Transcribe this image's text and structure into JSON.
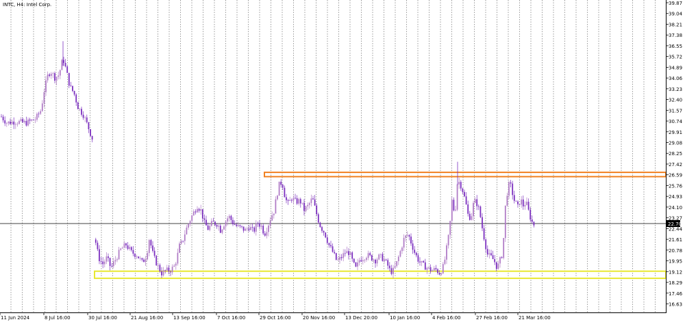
{
  "header": {
    "symbol_line": "INTC, H4: Intel Corp."
  },
  "colors": {
    "bull": "#b07cc6",
    "bear": "#7b2fbf",
    "grid": "#555555",
    "resistance": "#f08020",
    "support": "#e8e830",
    "current": "#000000"
  },
  "chart_data": {
    "type": "candlestick",
    "title": "INTC, H4: Intel Corp.",
    "y_ticks": [
      "39.87",
      "39.04",
      "38.21",
      "37.38",
      "36.55",
      "35.72",
      "34.89",
      "34.06",
      "33.23",
      "32.40",
      "31.57",
      "30.74",
      "29.91",
      "29.08",
      "28.25",
      "27.42",
      "26.59",
      "25.76",
      "24.93",
      "24.10",
      "23.27",
      "22.44",
      "21.61",
      "20.78",
      "19.95",
      "19.12",
      "18.29",
      "17.46",
      "16.63"
    ],
    "ylim": [
      16.63,
      39.87
    ],
    "x_ticks": [
      "11 Jun 2024",
      "8 Jul 16:00",
      "30 Jul 16:00",
      "21 Aug 16:00",
      "13 Sep 16:00",
      "7 Oct 16:00",
      "29 Oct 16:00",
      "20 Nov 16:00",
      "13 Dec 20:00",
      "10 Jan 16:00",
      "4 Feb 16:00",
      "27 Feb 16:00",
      "21 Mar 16:00"
    ],
    "current_price": "22.70",
    "zones": [
      {
        "name": "resistance",
        "low": 26.45,
        "high": 26.78
      },
      {
        "name": "support",
        "low": 18.6,
        "high": 19.15
      }
    ],
    "path_anchors": [
      [
        0,
        31.2
      ],
      [
        10,
        30.6
      ],
      [
        22,
        30.7
      ],
      [
        38,
        30.6
      ],
      [
        52,
        30.9
      ],
      [
        60,
        31.6
      ],
      [
        64,
        33.0
      ],
      [
        70,
        34.3
      ],
      [
        74,
        34.6
      ],
      [
        80,
        34.1
      ],
      [
        86,
        34.3
      ],
      [
        92,
        35.6
      ],
      [
        96,
        34.8
      ],
      [
        102,
        33.4
      ],
      [
        108,
        32.9
      ],
      [
        114,
        31.8
      ],
      [
        122,
        31.2
      ],
      [
        130,
        30.1
      ],
      [
        136,
        29.2
      ],
      [
        139,
        21.6
      ],
      [
        144,
        20.2
      ],
      [
        150,
        19.7
      ],
      [
        156,
        20.2
      ],
      [
        162,
        19.4
      ],
      [
        168,
        20.0
      ],
      [
        176,
        20.8
      ],
      [
        184,
        21.2
      ],
      [
        192,
        20.6
      ],
      [
        200,
        20.4
      ],
      [
        208,
        19.8
      ],
      [
        214,
        20.4
      ],
      [
        218,
        21.7
      ],
      [
        224,
        20.3
      ],
      [
        230,
        19.6
      ],
      [
        236,
        19.0
      ],
      [
        242,
        19.2
      ],
      [
        248,
        19.2
      ],
      [
        254,
        19.5
      ],
      [
        258,
        20.1
      ],
      [
        262,
        21.1
      ],
      [
        266,
        21.4
      ],
      [
        270,
        22.1
      ],
      [
        274,
        22.7
      ],
      [
        280,
        23.4
      ],
      [
        288,
        24.2
      ],
      [
        294,
        23.8
      ],
      [
        298,
        22.9
      ],
      [
        304,
        22.4
      ],
      [
        310,
        22.9
      ],
      [
        318,
        22.8
      ],
      [
        322,
        22.3
      ],
      [
        328,
        22.9
      ],
      [
        334,
        23.4
      ],
      [
        340,
        22.9
      ],
      [
        346,
        22.6
      ],
      [
        352,
        22.5
      ],
      [
        358,
        22.3
      ],
      [
        364,
        22.6
      ],
      [
        370,
        22.2
      ],
      [
        376,
        22.9
      ],
      [
        382,
        22.6
      ],
      [
        386,
        22.0
      ],
      [
        390,
        22.5
      ],
      [
        396,
        23.4
      ],
      [
        400,
        23.8
      ],
      [
        404,
        25.0
      ],
      [
        408,
        25.9
      ],
      [
        412,
        26.0
      ],
      [
        416,
        24.9
      ],
      [
        420,
        24.3
      ],
      [
        426,
        24.8
      ],
      [
        432,
        24.5
      ],
      [
        438,
        24.6
      ],
      [
        444,
        23.9
      ],
      [
        450,
        24.2
      ],
      [
        456,
        24.8
      ],
      [
        460,
        24.0
      ],
      [
        464,
        23.2
      ],
      [
        468,
        22.6
      ],
      [
        474,
        22.1
      ],
      [
        480,
        21.2
      ],
      [
        486,
        20.6
      ],
      [
        492,
        19.9
      ],
      [
        498,
        20.2
      ],
      [
        504,
        20.6
      ],
      [
        510,
        20.6
      ],
      [
        516,
        19.7
      ],
      [
        520,
        19.3
      ],
      [
        524,
        20.0
      ],
      [
        530,
        20.2
      ],
      [
        536,
        20.4
      ],
      [
        542,
        20.2
      ],
      [
        548,
        20.0
      ],
      [
        554,
        20.3
      ],
      [
        560,
        20.1
      ],
      [
        566,
        19.6
      ],
      [
        570,
        19.1
      ],
      [
        574,
        19.2
      ],
      [
        578,
        19.6
      ],
      [
        584,
        20.6
      ],
      [
        590,
        21.7
      ],
      [
        596,
        22.0
      ],
      [
        600,
        21.4
      ],
      [
        606,
        20.5
      ],
      [
        612,
        19.9
      ],
      [
        618,
        19.6
      ],
      [
        624,
        19.4
      ],
      [
        630,
        19.2
      ],
      [
        636,
        19.3
      ],
      [
        642,
        19.0
      ],
      [
        648,
        19.6
      ],
      [
        652,
        20.9
      ],
      [
        656,
        22.2
      ],
      [
        660,
        24.7
      ],
      [
        664,
        23.4
      ],
      [
        668,
        26.2
      ],
      [
        672,
        25.9
      ],
      [
        676,
        25.3
      ],
      [
        680,
        24.4
      ],
      [
        684,
        23.3
      ],
      [
        688,
        23.4
      ],
      [
        692,
        24.6
      ],
      [
        696,
        24.4
      ],
      [
        700,
        23.8
      ],
      [
        704,
        22.5
      ],
      [
        708,
        21.4
      ],
      [
        712,
        20.4
      ],
      [
        718,
        20.2
      ],
      [
        722,
        19.9
      ],
      [
        726,
        19.4
      ],
      [
        730,
        20.0
      ],
      [
        734,
        20.6
      ],
      [
        738,
        24.3
      ],
      [
        742,
        25.8
      ],
      [
        746,
        25.7
      ],
      [
        750,
        24.7
      ],
      [
        756,
        24.1
      ],
      [
        760,
        24.7
      ],
      [
        764,
        24.2
      ],
      [
        768,
        24.5
      ],
      [
        772,
        23.7
      ],
      [
        776,
        23.0
      ],
      [
        780,
        22.7
      ]
    ]
  }
}
